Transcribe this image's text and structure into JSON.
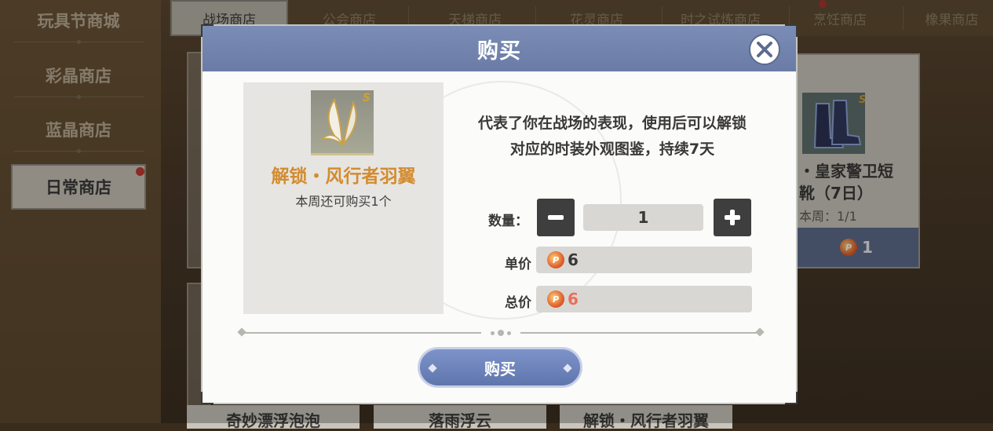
{
  "sidebar": {
    "items": [
      {
        "label": "玩具节商城"
      },
      {
        "label": "彩晶商店"
      },
      {
        "label": "蓝晶商店"
      },
      {
        "label": "日常商店"
      }
    ]
  },
  "tabs": [
    {
      "label": "战场商店"
    },
    {
      "label": "公会商店"
    },
    {
      "label": "天梯商店"
    },
    {
      "label": "花灵商店"
    },
    {
      "label": "时之试炼商店"
    },
    {
      "label": "烹饪商店"
    },
    {
      "label": "橡果商店"
    }
  ],
  "background_cards": {
    "boot": {
      "name": "・皇家警卫短\n靴（7日）",
      "limit": "本周：1/1",
      "price": "1",
      "grade": "S"
    },
    "bottom_labels": [
      "奇妙漂浮泡泡",
      "落雨浮云",
      "解锁・风行者羽翼"
    ]
  },
  "modal": {
    "title": "购买",
    "item": {
      "grade": "S",
      "name": "解锁・风行者羽翼",
      "limit": "本周还可购买1个"
    },
    "description_lines": [
      "代表了你在战场的表现，使用后可以解锁",
      "对应的时装外观图鉴，持续7天"
    ],
    "quantity_label": "数量：",
    "quantity_value": "1",
    "unit_price_label": "单价",
    "unit_price": "6",
    "total_price_label": "总价",
    "total_price": "6",
    "buy_button": "购买",
    "total_price_color": "#e8705a",
    "accent_color": "#6a7ca6"
  }
}
